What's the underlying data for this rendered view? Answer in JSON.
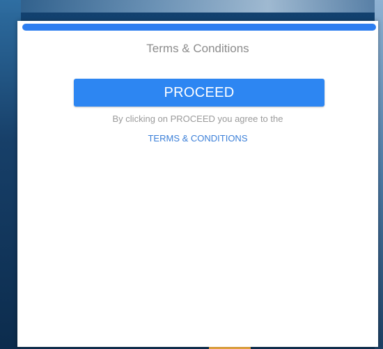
{
  "modal": {
    "title": "Terms & Conditions",
    "proceed_label": "PROCEED",
    "agree_text": "By clicking on PROCEED you agree to the",
    "terms_link": "TERMS & CONDITIONS"
  },
  "colors": {
    "accent": "#2d86f2",
    "link": "#3b7fd8",
    "muted_text": "#9a9a9a"
  }
}
